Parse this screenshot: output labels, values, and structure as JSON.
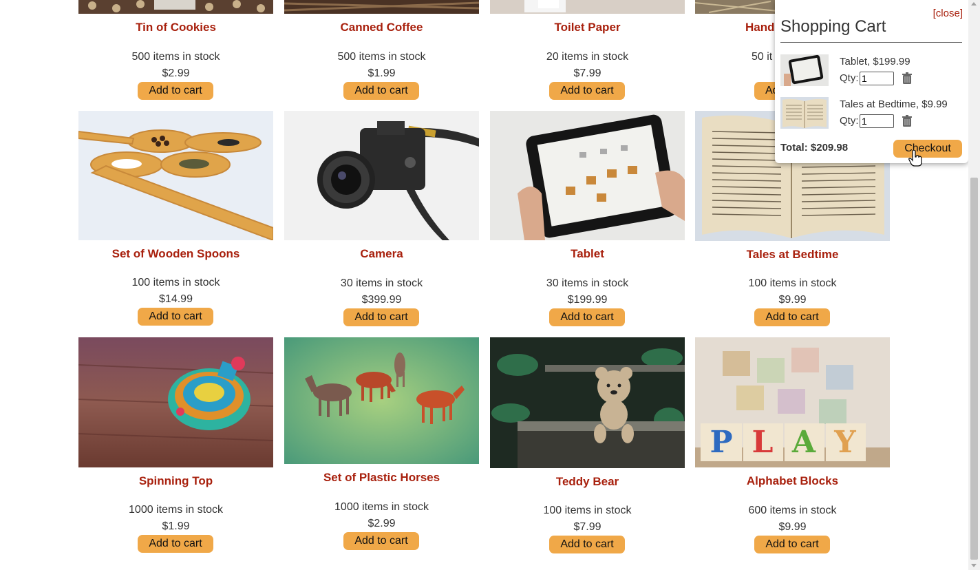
{
  "products": [
    {
      "name": "Tin of Cookies",
      "stock": "500 items in stock",
      "price": "$2.99",
      "button": "Add to cart",
      "image": "cookies-tin-photo"
    },
    {
      "name": "Canned Coffee",
      "stock": "500 items in stock",
      "price": "$1.99",
      "button": "Add to cart",
      "image": "coffee-beans-photo"
    },
    {
      "name": "Toilet Paper",
      "stock": "20 items in stock",
      "price": "$7.99",
      "button": "Add to cart",
      "image": "toilet-paper-photo"
    },
    {
      "name": "Hand",
      "stock": "50 it",
      "price": "",
      "button": "Ad",
      "image": "hand-photo"
    },
    {
      "name": "Set of Wooden Spoons",
      "stock": "100 items in stock",
      "price": "$14.99",
      "button": "Add to cart",
      "image": "wooden-spoons-photo"
    },
    {
      "name": "Camera",
      "stock": "30 items in stock",
      "price": "$399.99",
      "button": "Add to cart",
      "image": "camera-photo"
    },
    {
      "name": "Tablet",
      "stock": "30 items in stock",
      "price": "$199.99",
      "button": "Add to cart",
      "image": "tablet-photo"
    },
    {
      "name": "Tales at Bedtime",
      "stock": "100 items in stock",
      "price": "$9.99",
      "button": "Add to cart",
      "image": "open-book-photo"
    },
    {
      "name": "Spinning Top",
      "stock": "1000 items in stock",
      "price": "$1.99",
      "button": "Add to cart",
      "image": "spinning-top-photo"
    },
    {
      "name": "Set of Plastic Horses",
      "stock": "1000 items in stock",
      "price": "$2.99",
      "button": "Add to cart",
      "image": "plastic-horses-photo"
    },
    {
      "name": "Teddy Bear",
      "stock": "100 items in stock",
      "price": "$7.99",
      "button": "Add to cart",
      "image": "teddy-bear-photo"
    },
    {
      "name": "Alphabet Blocks",
      "stock": "600 items in stock",
      "price": "$9.99",
      "button": "Add to cart",
      "image": "alphabet-blocks-photo"
    }
  ],
  "cart": {
    "close": "[close]",
    "title": "Shopping Cart",
    "items": [
      {
        "label": "Tablet, $199.99",
        "qty_label": "Qty:",
        "qty": "1",
        "image": "tablet-photo"
      },
      {
        "label": "Tales at Bedtime, $9.99",
        "qty_label": "Qty:",
        "qty": "1",
        "image": "open-book-photo"
      }
    ],
    "total": "Total: $209.98",
    "checkout": "Checkout"
  },
  "colors": {
    "accent": "#f0a848",
    "title": "#a8200d"
  }
}
